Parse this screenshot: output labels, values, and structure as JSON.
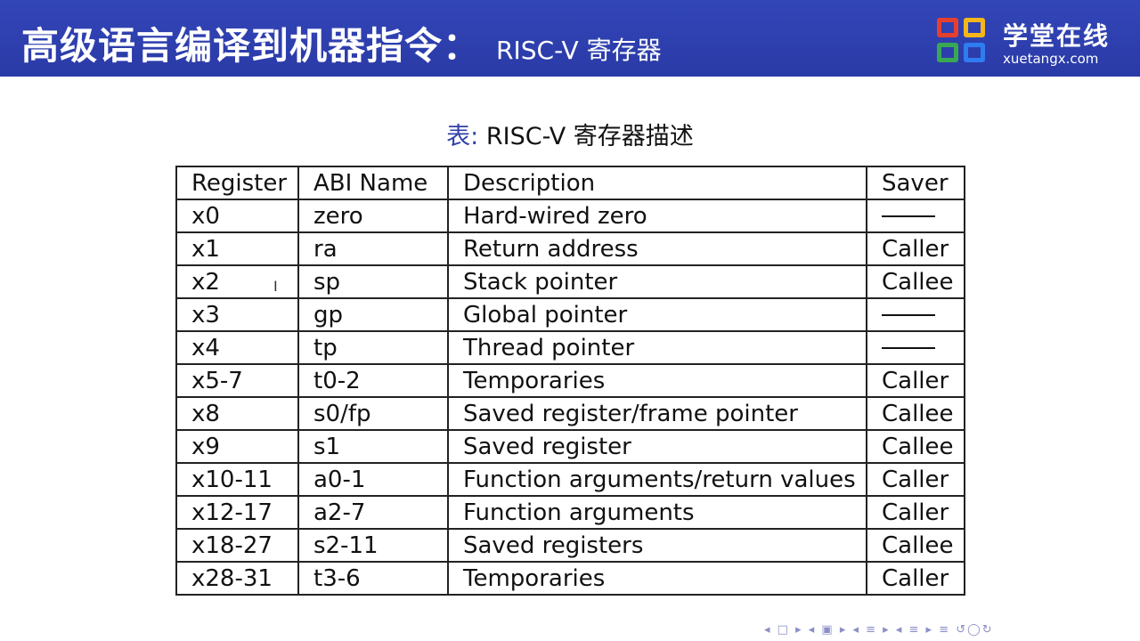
{
  "header": {
    "title_main": "高级语言编译到机器指令",
    "title_separator": "：",
    "title_sub": "RISC-V 寄存器"
  },
  "logo": {
    "name_cn": "学堂在线",
    "domain": "xuetangx.com",
    "colors": [
      "#e5402f",
      "#f4b61a",
      "#39a853",
      "#2f7cf0"
    ]
  },
  "caption": {
    "prefix": "表:",
    "text": "RISC-V 寄存器描述"
  },
  "table": {
    "columns": [
      "Register",
      "ABI Name",
      "Description",
      "Saver"
    ],
    "rows": [
      {
        "register": "x0",
        "abi": "zero",
        "description": "Hard-wired zero",
        "saver": "——"
      },
      {
        "register": "x1",
        "abi": "ra",
        "description": "Return address",
        "saver": "Caller"
      },
      {
        "register": "x2",
        "abi": "sp",
        "description": "Stack pointer",
        "saver": "Callee"
      },
      {
        "register": "x3",
        "abi": "gp",
        "description": "Global pointer",
        "saver": "——"
      },
      {
        "register": "x4",
        "abi": "tp",
        "description": "Thread pointer",
        "saver": "——"
      },
      {
        "register": "x5-7",
        "abi": "t0-2",
        "description": "Temporaries",
        "saver": "Caller"
      },
      {
        "register": "x8",
        "abi": "s0/fp",
        "description": "Saved register/frame pointer",
        "saver": "Callee"
      },
      {
        "register": "x9",
        "abi": "s1",
        "description": "Saved register",
        "saver": "Callee"
      },
      {
        "register": "x10-11",
        "abi": "a0-1",
        "description": "Function arguments/return values",
        "saver": "Caller"
      },
      {
        "register": "x12-17",
        "abi": "a2-7",
        "description": "Function arguments",
        "saver": "Caller"
      },
      {
        "register": "x18-27",
        "abi": "s2-11",
        "description": "Saved registers",
        "saver": "Callee"
      },
      {
        "register": "x28-31",
        "abi": "t3-6",
        "description": "Temporaries",
        "saver": "Caller"
      }
    ]
  },
  "nav": {
    "icons": [
      "nav-first-icon",
      "nav-prev-frame-icon",
      "nav-prev-section-icon",
      "nav-prev-subsection-icon",
      "nav-align-icon",
      "nav-search-icon"
    ]
  }
}
